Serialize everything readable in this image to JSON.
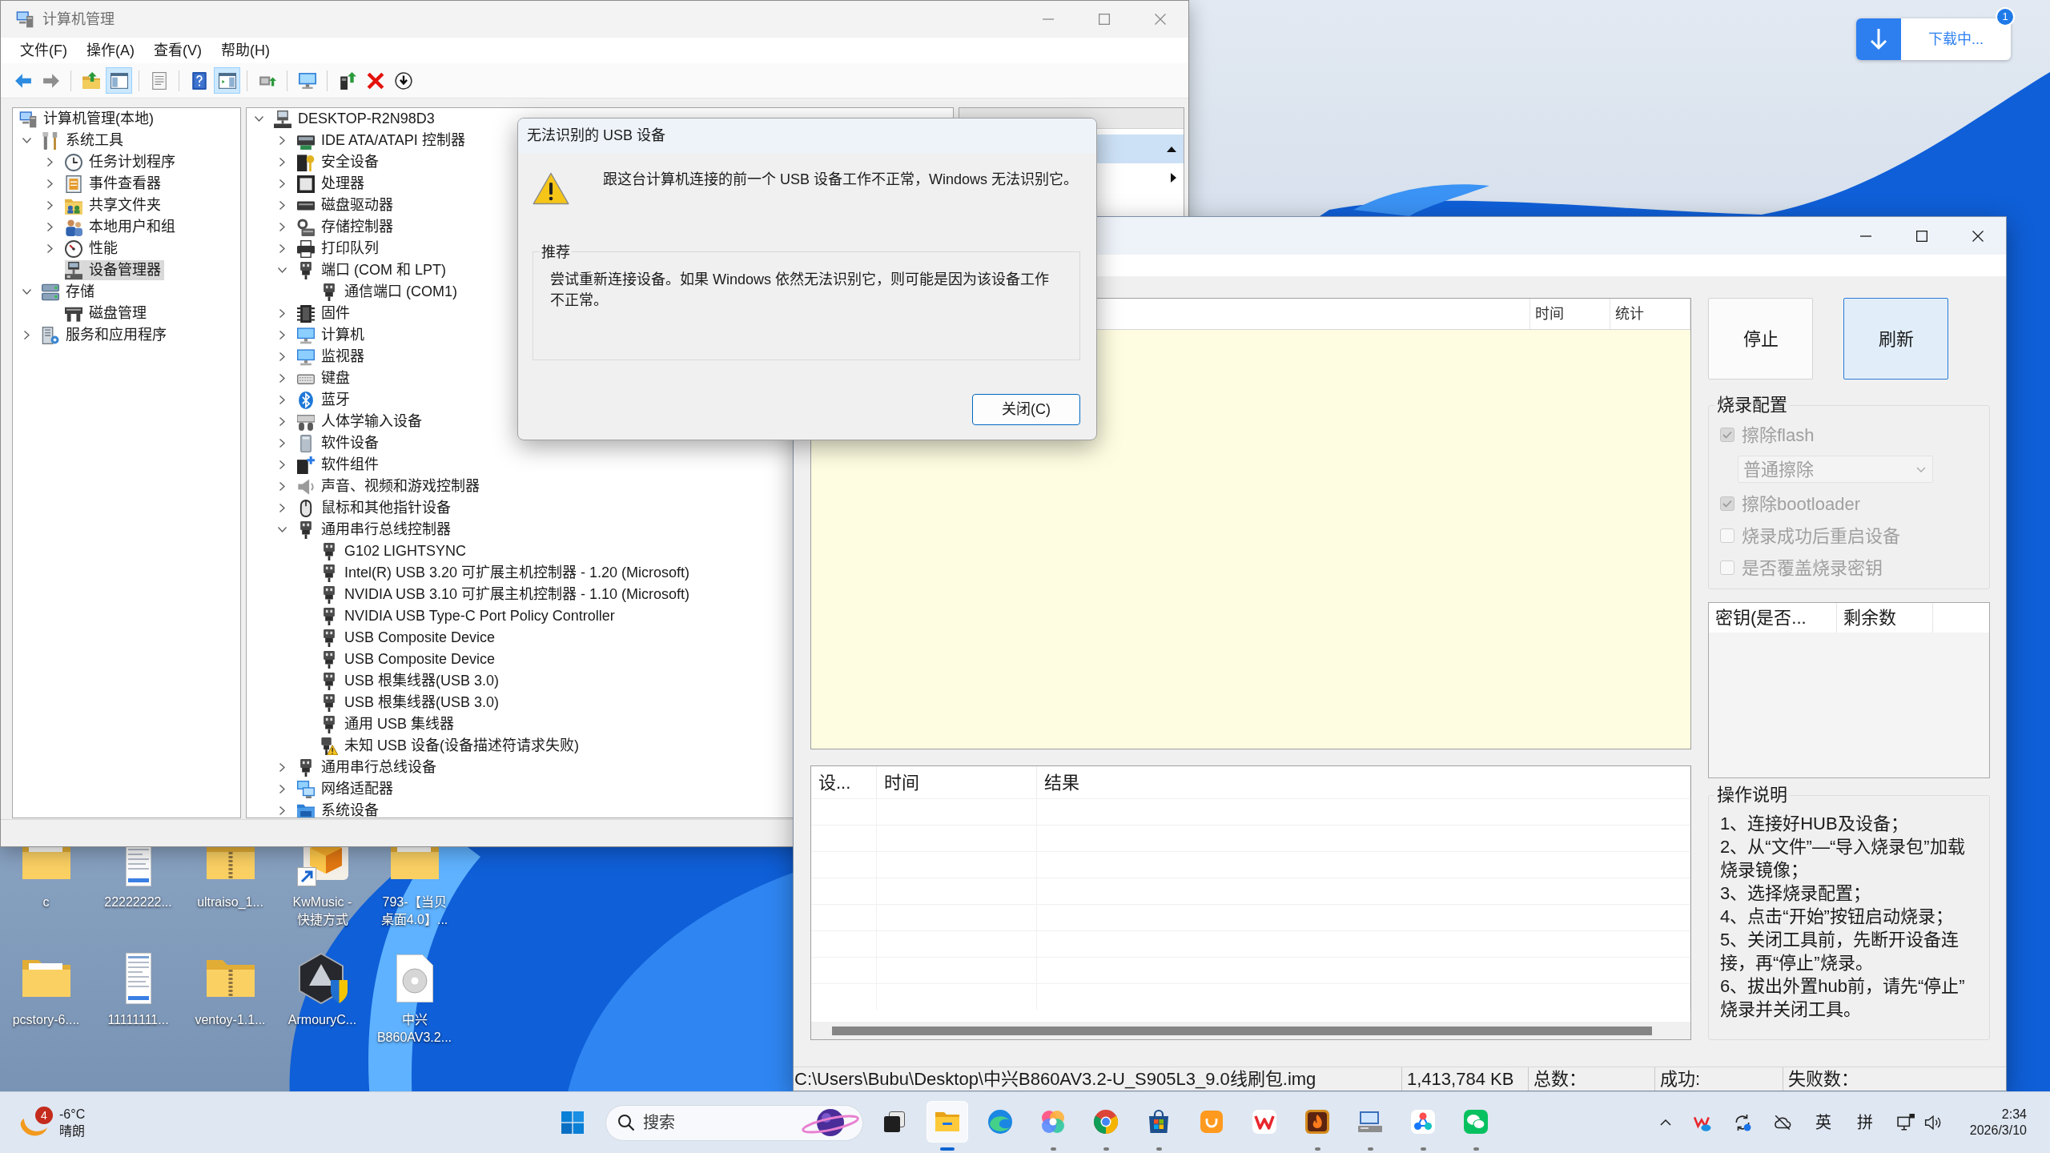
{
  "computer_management": {
    "title": "计算机管理",
    "menu": [
      "文件(F)",
      "操作(A)",
      "查看(V)",
      "帮助(H)"
    ],
    "toolbar": [
      [
        {
          "kind": "back",
          "pressed": false,
          "disabled": false
        },
        {
          "kind": "forward",
          "pressed": false,
          "disabled": true
        }
      ],
      [
        {
          "kind": "upfolder",
          "pressed": false,
          "disabled": false
        },
        {
          "kind": "treepane",
          "pressed": true,
          "disabled": false
        }
      ],
      [
        {
          "kind": "properties",
          "pressed": false,
          "disabled": false
        }
      ],
      [
        {
          "kind": "help",
          "pressed": false,
          "disabled": false
        },
        {
          "kind": "actionpane",
          "pressed": true,
          "disabled": false
        }
      ],
      [
        {
          "kind": "scan",
          "pressed": false,
          "disabled": false
        }
      ],
      [
        {
          "kind": "monitor",
          "pressed": false,
          "disabled": false
        }
      ],
      [
        {
          "kind": "update",
          "pressed": false,
          "disabled": false
        },
        {
          "kind": "uninstall",
          "pressed": false,
          "disabled": false
        },
        {
          "kind": "disable",
          "pressed": false,
          "disabled": false
        }
      ]
    ],
    "console_tree": [
      {
        "label": "计算机管理(本地)",
        "kind": "computer",
        "selected": false,
        "children": [
          {
            "label": "系统工具",
            "kind": "tools",
            "expanded": true,
            "selected": false,
            "children": [
              {
                "label": "任务计划程序",
                "kind": "clock",
                "expanded": false,
                "selected": false
              },
              {
                "label": "事件查看器",
                "kind": "eventlog",
                "expanded": false,
                "selected": false
              },
              {
                "label": "共享文件夹",
                "kind": "share",
                "expanded": false,
                "selected": false
              },
              {
                "label": "本地用户和组",
                "kind": "users",
                "expanded": false,
                "selected": false
              },
              {
                "label": "性能",
                "kind": "gauge",
                "expanded": false,
                "selected": false
              },
              {
                "label": "设备管理器",
                "kind": "devices",
                "selected": true
              }
            ]
          },
          {
            "label": "存储",
            "kind": "storage",
            "expanded": true,
            "selected": false,
            "children": [
              {
                "label": "磁盘管理",
                "kind": "disk",
                "selected": false
              }
            ]
          },
          {
            "label": "服务和应用程序",
            "kind": "services",
            "expanded": false,
            "selected": false
          }
        ]
      }
    ],
    "device_tree": [
      {
        "label": "DESKTOP-R2N98D3",
        "kind": "computer",
        "expanded": true,
        "selected": false,
        "children": [
          {
            "label": "IDE ATA/ATAPI 控制器",
            "kind": "ide",
            "expanded": false,
            "selected": false
          },
          {
            "label": "安全设备",
            "kind": "security",
            "expanded": false,
            "selected": false
          },
          {
            "label": "处理器",
            "kind": "cpu",
            "expanded": false,
            "selected": false
          },
          {
            "label": "磁盘驱动器",
            "kind": "disk",
            "expanded": false,
            "selected": false
          },
          {
            "label": "存储控制器",
            "kind": "storage",
            "expanded": false,
            "selected": false
          },
          {
            "label": "打印队列",
            "kind": "printer",
            "expanded": false,
            "selected": false
          },
          {
            "label": "端口 (COM 和 LPT)",
            "kind": "port",
            "expanded": true,
            "selected": false,
            "children": [
              {
                "label": "通信端口 (COM1)",
                "kind": "port",
                "selected": false
              }
            ]
          },
          {
            "label": "固件",
            "kind": "firmware",
            "expanded": false,
            "selected": false
          },
          {
            "label": "计算机",
            "kind": "pc",
            "expanded": false,
            "selected": false
          },
          {
            "label": "监视器",
            "kind": "monitor",
            "expanded": false,
            "selected": false
          },
          {
            "label": "键盘",
            "kind": "keyboard",
            "expanded": false,
            "selected": false
          },
          {
            "label": "蓝牙",
            "kind": "bluetooth",
            "expanded": false,
            "selected": false
          },
          {
            "label": "人体学输入设备",
            "kind": "hid",
            "expanded": false,
            "selected": false
          },
          {
            "label": "软件设备",
            "kind": "software",
            "expanded": false,
            "selected": false
          },
          {
            "label": "软件组件",
            "kind": "component",
            "expanded": false,
            "selected": false
          },
          {
            "label": "声音、视频和游戏控制器",
            "kind": "sound",
            "expanded": false,
            "selected": false
          },
          {
            "label": "鼠标和其他指针设备",
            "kind": "mouse",
            "expanded": false,
            "selected": false
          },
          {
            "label": "通用串行总线控制器",
            "kind": "usb",
            "expanded": true,
            "selected": false,
            "children": [
              {
                "label": "G102 LIGHTSYNC",
                "kind": "usb",
                "selected": false
              },
              {
                "label": "Intel(R) USB 3.20 可扩展主机控制器 - 1.20 (Microsoft)",
                "kind": "usb",
                "selected": false
              },
              {
                "label": "NVIDIA USB 3.10 可扩展主机控制器 - 1.10 (Microsoft)",
                "kind": "usb",
                "selected": false
              },
              {
                "label": "NVIDIA USB Type-C Port Policy Controller",
                "kind": "usb",
                "selected": false
              },
              {
                "label": "USB Composite Device",
                "kind": "usb",
                "selected": false
              },
              {
                "label": "USB Composite Device",
                "kind": "usb",
                "selected": false
              },
              {
                "label": "USB 根集线器(USB 3.0)",
                "kind": "usb",
                "selected": false
              },
              {
                "label": "USB 根集线器(USB 3.0)",
                "kind": "usb",
                "selected": false
              },
              {
                "label": "通用 USB 集线器",
                "kind": "usb",
                "selected": false
              },
              {
                "label": "未知 USB 设备(设备描述符请求失败)",
                "kind": "usbwarn",
                "selected": false
              }
            ]
          },
          {
            "label": "通用串行总线设备",
            "kind": "usb",
            "expanded": false,
            "selected": false
          },
          {
            "label": "网络适配器",
            "kind": "network",
            "expanded": false,
            "selected": false
          },
          {
            "label": "系统设备",
            "kind": "system",
            "expanded": false,
            "selected": false
          }
        ]
      }
    ],
    "actions": [
      {
        "kind": "section",
        "selected": true
      },
      {
        "kind": "submenu",
        "selected": false
      }
    ]
  },
  "dialog": {
    "title": "无法识别的 USB 设备",
    "message": "跟这台计算机连接的前一个 USB 设备工作不正常，Windows 无法识别它。",
    "group_title": "推荐",
    "group_text": "尝试重新连接设备。如果 Windows 依然无法识别它，则可能是因为该设备工作不正常。",
    "button": "关闭(C)"
  },
  "flash_tool": {
    "top_list": {
      "columns": [
        "时间",
        "统计"
      ]
    },
    "buttons": [
      {
        "label": "停止",
        "highlighted": false
      },
      {
        "label": "刷新",
        "highlighted": true
      }
    ],
    "config": {
      "title": "烧录配置",
      "options": [
        {
          "kind": "checkbox",
          "label": "擦除flash",
          "checked": true,
          "disabled": true
        },
        {
          "kind": "select",
          "value": "普通擦除",
          "disabled": true
        },
        {
          "kind": "checkbox",
          "label": "擦除bootloader",
          "checked": true,
          "disabled": true
        },
        {
          "kind": "checkbox",
          "label": "烧录成功后重启设备",
          "checked": false,
          "disabled": true
        },
        {
          "kind": "checkbox",
          "label": "是否覆盖烧录密钥",
          "checked": false,
          "disabled": true
        }
      ]
    },
    "key_list": {
      "columns": [
        "密钥(是否...",
        "剩余数"
      ]
    },
    "instructions": {
      "title": "操作说明",
      "steps": [
        "1、连接好HUB及设备；",
        "2、从“文件”—“导入烧录包”加载烧录镜像；",
        "3、选择烧录配置；",
        "4、点击“开始”按钮启动烧录；",
        "5、关闭工具前，先断开设备连接，再“停止”烧录。",
        "6、拔出外置hub前，请先“停止”烧录并关闭工具。"
      ]
    },
    "log_list": {
      "columns": [
        "设...",
        "时间",
        "结果"
      ]
    },
    "status_bar": [
      "C:\\Users\\Bubu\\Desktop\\中兴B860AV3.2-U_S905L3_9.0线刷包.img",
      "1,413,784 KB",
      "总数：",
      "成功:",
      "失败数："
    ]
  },
  "download": {
    "label": "下载中...",
    "badge": "1"
  },
  "desktop_icons": [
    {
      "label": "c",
      "kind": "folder"
    },
    {
      "label": "22222222...",
      "kind": "document"
    },
    {
      "label": "ultraiso_1...",
      "kind": "zip"
    },
    {
      "label": "KwMusic - 快捷方式",
      "kind": "shortcut"
    },
    {
      "label": "793-【当贝桌面4.0】...",
      "kind": "folder"
    },
    {
      "label": "pcstory-6....",
      "kind": "folder"
    },
    {
      "label": "11111111...",
      "kind": "document"
    },
    {
      "label": "ventoy-1.1...",
      "kind": "zip"
    },
    {
      "label": "ArmouryC...",
      "kind": "app"
    },
    {
      "label": "中兴B860AV3.2...",
      "kind": "disc"
    }
  ],
  "taskbar": {
    "weather": {
      "badge": "4",
      "temperature": "-6°C",
      "condition": "晴朗"
    },
    "search": {
      "placeholder": "搜索"
    },
    "apps": [
      {
        "kind": "taskview",
        "running": false,
        "selected": false
      },
      {
        "kind": "folder",
        "running": true,
        "selected": true
      },
      {
        "kind": "swirl",
        "running": false,
        "selected": false
      },
      {
        "kind": "pinwheel",
        "running": true,
        "selected": false
      },
      {
        "kind": "ball",
        "running": true,
        "selected": false
      },
      {
        "kind": "bag",
        "running": true,
        "selected": false
      },
      {
        "kind": "smile",
        "running": false,
        "selected": false
      },
      {
        "kind": "zigzag",
        "running": false,
        "selected": false
      },
      {
        "kind": "flame",
        "running": true,
        "selected": false
      },
      {
        "kind": "pc",
        "running": true,
        "selected": false
      },
      {
        "kind": "dots",
        "running": true,
        "selected": false
      },
      {
        "kind": "chat",
        "running": true,
        "selected": false
      }
    ],
    "tray": [
      {
        "kind": "chevron"
      },
      {
        "kind": "cloudmark"
      },
      {
        "kind": "sync"
      },
      {
        "kind": "cloudoff"
      },
      {
        "kind": "text",
        "label": "英"
      },
      {
        "kind": "text",
        "label": "拼"
      },
      {
        "kind": "netsound"
      }
    ],
    "clock": {
      "time": "2:34",
      "date": "2026/3/10"
    }
  }
}
